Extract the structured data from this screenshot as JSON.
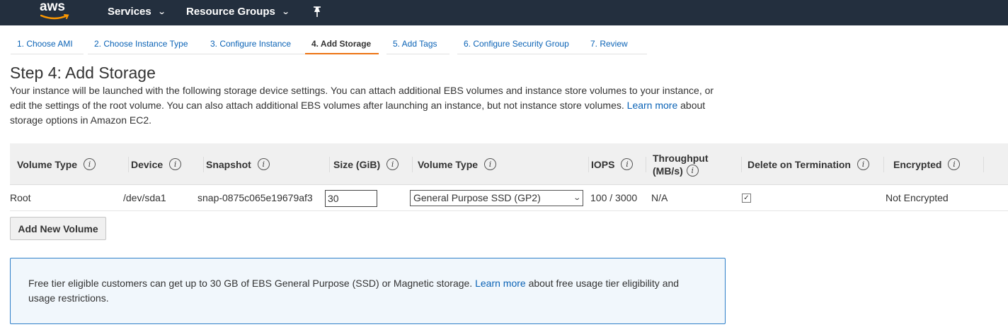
{
  "nav": {
    "logo_text": "aws",
    "services_label": "Services",
    "resource_groups_label": "Resource Groups",
    "pin_icon": "pin-icon",
    "bg_color": "#232f3e"
  },
  "tabs": [
    {
      "label": "1. Choose AMI",
      "active": false
    },
    {
      "label": "2. Choose Instance Type",
      "active": false
    },
    {
      "label": "3. Configure Instance",
      "active": false
    },
    {
      "label": "4. Add Storage",
      "active": true
    },
    {
      "label": "5. Add Tags",
      "active": false
    },
    {
      "label": "6. Configure Security Group",
      "active": false
    },
    {
      "label": "7. Review",
      "active": false
    }
  ],
  "page": {
    "title": "Step 4: Add Storage",
    "intro_text": "Your instance will be launched with the following storage device settings. You can attach additional EBS volumes and instance store volumes to your instance, or edit the settings of the root volume. You can also attach additional EBS volumes after launching an instance, but not instance store volumes.",
    "intro_link": "Learn more",
    "intro_suffix": "about storage options in Amazon EC2."
  },
  "table": {
    "headers": {
      "volume_type": "Volume Type",
      "device": "Device",
      "snapshot": "Snapshot",
      "size": "Size (GiB)",
      "volume_type2": "Volume Type",
      "iops": "IOPS",
      "throughput_line1": "Throughput",
      "throughput_line2": "(MB/s)",
      "delete_on_termination": "Delete on Termination",
      "encrypted": "Encrypted"
    },
    "row": {
      "volume_type": "Root",
      "device": "/dev/sda1",
      "snapshot": "snap-0875c065e19679af3",
      "size": "30",
      "volume_type_select": "General Purpose SSD (GP2)",
      "iops": "100 / 3000",
      "throughput": "N/A",
      "delete_on_termination": true,
      "encrypted": "Not Encrypted"
    }
  },
  "add_volume_button": "Add New Volume",
  "free_tier": {
    "text": "Free tier eligible customers can get up to 30 GB of EBS General Purpose (SSD) or Magnetic storage.",
    "link": "Learn more",
    "suffix": "about free usage tier eligibility and usage restrictions."
  },
  "colors": {
    "accent": "#ec7211",
    "link": "#0b63b6",
    "info_border": "#2e7fc9",
    "info_bg": "#f1f7fc"
  }
}
